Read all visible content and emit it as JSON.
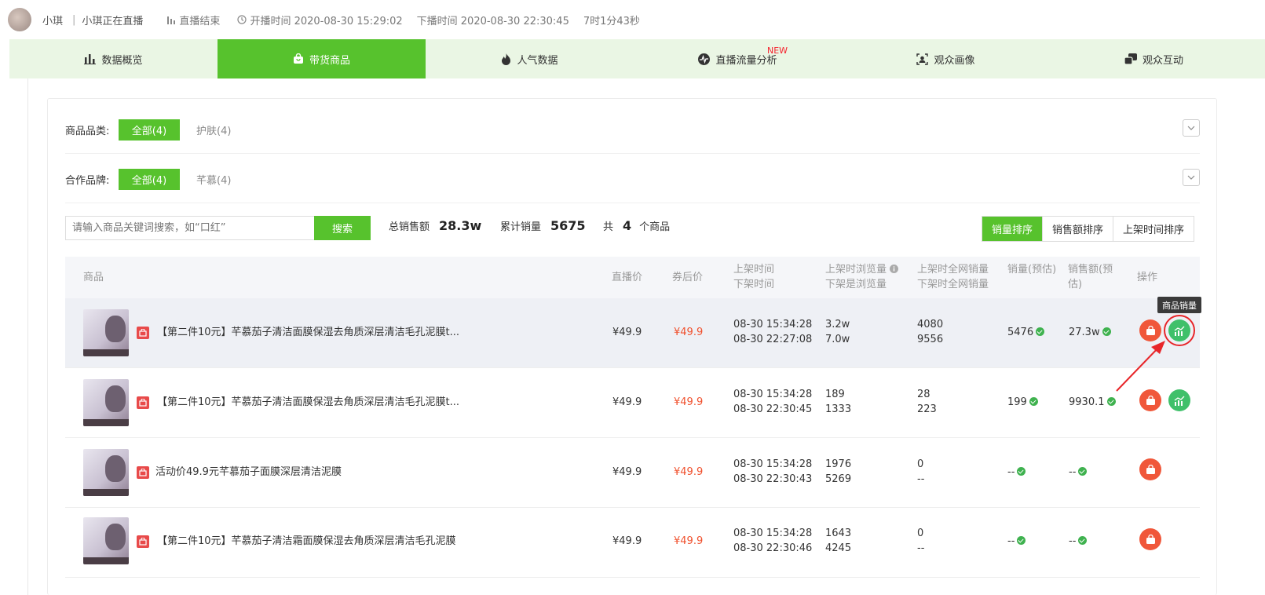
{
  "header": {
    "name": "小琪",
    "live_status": "小琪正在直播",
    "ended": "直播结束",
    "start": "开播时间 2020-08-30 15:29:02",
    "end": "下播时间 2020-08-30 22:30:45",
    "duration": "7时1分43秒"
  },
  "tabs": [
    {
      "label": "数据概览",
      "icon": "bar-chart-icon"
    },
    {
      "label": "带货商品",
      "icon": "shopping-bag-icon"
    },
    {
      "label": "人气数据",
      "icon": "fire-icon"
    },
    {
      "label": "直播流量分析",
      "icon": "pulse-icon",
      "badge": "NEW"
    },
    {
      "label": "观众画像",
      "icon": "portrait-icon"
    },
    {
      "label": "观众互动",
      "icon": "interaction-icon"
    }
  ],
  "filters": {
    "category_label": "商品品类:",
    "category_all": "全部(4)",
    "category_other": "护肤(4)",
    "brand_label": "合作品牌:",
    "brand_all": "全部(4)",
    "brand_other": "芊慕(4)"
  },
  "search": {
    "placeholder": "请输入商品关键词搜索，如“口红”",
    "button": "搜索"
  },
  "stats": {
    "total_sales_label": "总销售额",
    "total_sales_value": "28.3w",
    "total_volume_label": "累计销量",
    "total_volume_value": "5675",
    "count_prefix": "共",
    "count_value": "4",
    "count_suffix": "个商品"
  },
  "sort": [
    "销量排序",
    "销售额排序",
    "上架时间排序"
  ],
  "table": {
    "headers": {
      "product": "商品",
      "live_price": "直播价",
      "coupon_price": "券后价",
      "time_1": "上架时间",
      "time_2": "下架时间",
      "views_1": "上架时浏览量",
      "views_2": "下架是浏览量",
      "net_1": "上架时全网销量",
      "net_2": "下架时全网销量",
      "sales": "销量(预估)",
      "revenue": "销售额(预估)",
      "ops": "操作"
    },
    "rows": [
      {
        "name": "【第二件10元】芊慕茄子清洁面膜保湿去角质深层清洁毛孔泥膜t...",
        "live_price": "¥49.9",
        "coupon_price": "¥49.9",
        "on_time": "08-30 15:34:28",
        "off_time": "08-30 22:27:08",
        "views_on": "3.2w",
        "views_off": "7.0w",
        "net_on": "4080",
        "net_off": "9556",
        "sales": "5476",
        "revenue": "27.3w"
      },
      {
        "name": "【第二件10元】芊慕茄子清洁面膜保湿去角质深层清洁毛孔泥膜t...",
        "live_price": "¥49.9",
        "coupon_price": "¥49.9",
        "on_time": "08-30 15:34:28",
        "off_time": "08-30 22:30:45",
        "views_on": "189",
        "views_off": "1333",
        "net_on": "28",
        "net_off": "223",
        "sales": "199",
        "revenue": "9930.1"
      },
      {
        "name": "活动价49.9元芊慕茄子面膜深层清洁泥膜",
        "live_price": "¥49.9",
        "coupon_price": "¥49.9",
        "on_time": "08-30 15:34:28",
        "off_time": "08-30 22:30:43",
        "views_on": "1976",
        "views_off": "5269",
        "net_on": "0",
        "net_off": "--",
        "sales": "--",
        "revenue": "--"
      },
      {
        "name": "【第二件10元】芊慕茄子清洁霜面膜保湿去角质深层清洁毛孔泥膜",
        "live_price": "¥49.9",
        "coupon_price": "¥49.9",
        "on_time": "08-30 15:34:28",
        "off_time": "08-30 22:30:46",
        "views_on": "1643",
        "views_off": "4245",
        "net_on": "0",
        "net_off": "--",
        "sales": "--",
        "revenue": "--"
      }
    ]
  },
  "tooltip": "商品销量",
  "colors": {
    "accent": "#57c22d",
    "price_red": "#f0502d",
    "annotation_red": "#e8262a"
  }
}
